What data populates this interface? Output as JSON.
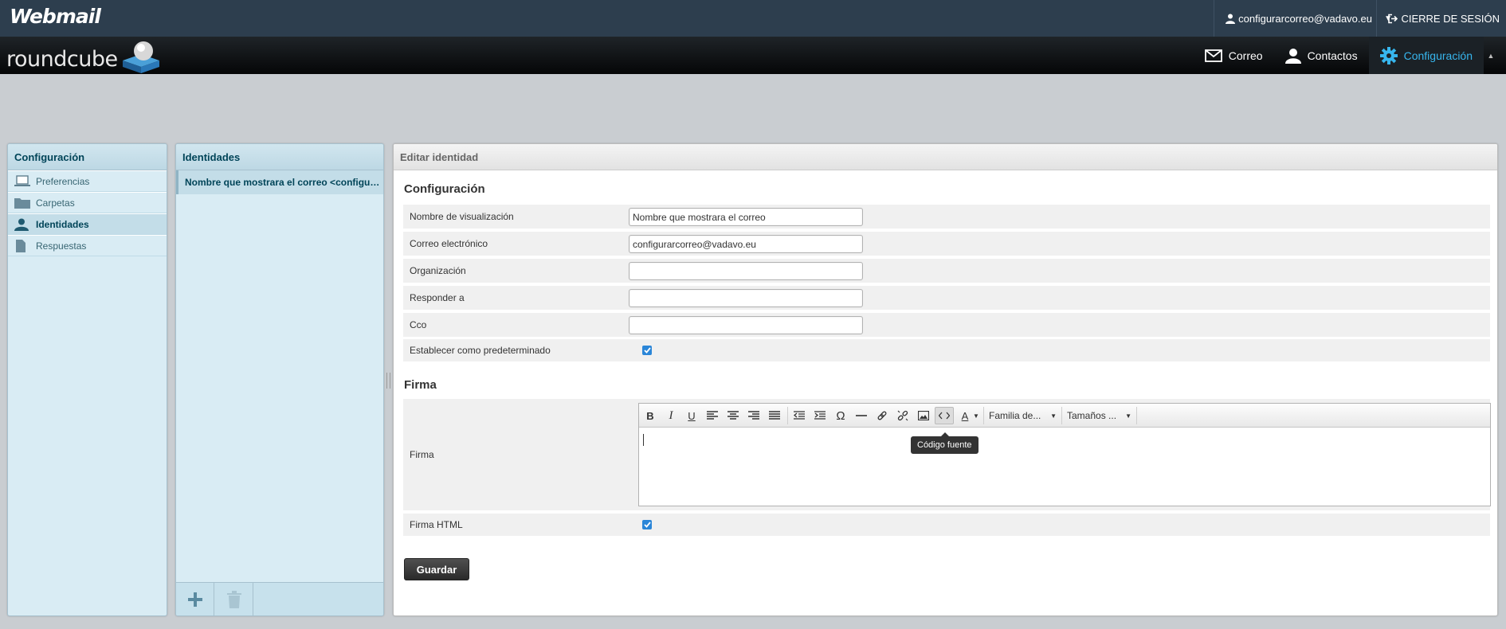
{
  "topbar": {
    "brand": "Webmail",
    "user_email": "configurarcorreo@vadavo.eu",
    "logout_label": "CIERRE DE SESIÓN"
  },
  "header": {
    "logo_text": "roundcube",
    "nav": [
      {
        "label": "Correo",
        "icon": "envelope-icon"
      },
      {
        "label": "Contactos",
        "icon": "person-icon"
      },
      {
        "label": "Configuración",
        "icon": "gear-icon",
        "active": true
      }
    ]
  },
  "settings": {
    "title": "Configuración",
    "items": [
      {
        "label": "Preferencias",
        "icon": "laptop-icon"
      },
      {
        "label": "Carpetas",
        "icon": "folder-icon"
      },
      {
        "label": "Identidades",
        "icon": "person-icon",
        "selected": true
      },
      {
        "label": "Respuestas",
        "icon": "document-icon"
      }
    ]
  },
  "identities": {
    "title": "Identidades",
    "items": [
      "Nombre que mostrara el correo <configurarcorreo@vadavo.eu>"
    ]
  },
  "edit": {
    "title": "Editar identidad",
    "config_section": "Configuración",
    "fields": [
      {
        "label": "Nombre de visualización",
        "value": "Nombre que mostrara el correo"
      },
      {
        "label": "Correo electrónico",
        "value": "configurarcorreo@vadavo.eu"
      },
      {
        "label": "Organización",
        "value": ""
      },
      {
        "label": "Responder a",
        "value": ""
      },
      {
        "label": "Cco",
        "value": ""
      }
    ],
    "default_label": "Establecer como predeterminado",
    "default_checked": true,
    "signature_section": "Firma",
    "signature_label": "Firma",
    "font_family_label": "Familia de...",
    "font_size_label": "Tamaños ...",
    "tooltip": "Código fuente",
    "html_signature_label": "Firma HTML",
    "html_signature_checked": true,
    "save_label": "Guardar"
  },
  "colors": {
    "topbar": "#2d3e4e",
    "accent": "#37b6ee",
    "panel_bg": "#d9ecf4",
    "checkbox": "#2b86d8"
  }
}
